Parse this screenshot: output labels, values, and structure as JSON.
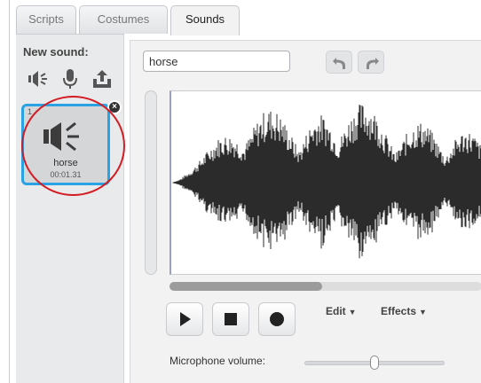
{
  "tabs": [
    {
      "label": "Scripts",
      "active": false
    },
    {
      "label": "Costumes",
      "active": false
    },
    {
      "label": "Sounds",
      "active": true
    }
  ],
  "sound_list": {
    "new_sound_label": "New sound:",
    "new_sound_icons": [
      "speaker-library-icon",
      "microphone-icon",
      "upload-icon"
    ],
    "selected_sound": {
      "number": "1",
      "name": "horse",
      "duration": "00:01.31"
    }
  },
  "editor": {
    "sound_name": "horse",
    "undo_icon": "undo-icon",
    "redo_icon": "redo-icon",
    "scroll_position": 0.49,
    "playback_buttons": [
      "play-icon",
      "stop-icon",
      "record-icon"
    ],
    "menus": {
      "edit": "Edit",
      "effects": "Effects"
    },
    "microphone_label": "Microphone volume:",
    "microphone_volume": 0.5
  },
  "colors": {
    "selection": "#29a3e3",
    "highlight_circle": "#d31c23",
    "waveform": "#2b2b2b"
  }
}
